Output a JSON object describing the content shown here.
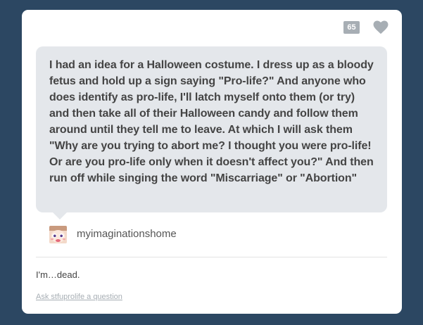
{
  "post": {
    "note_count": "65",
    "question": "I had an idea for a Halloween costume. I dress up as a bloody fetus and hold up a sign saying \"Pro-life?\" And anyone who does identify as pro-life, I'll latch myself onto them (or try) and then take all of their Halloween candy and follow them around until they tell me to leave. At which I will ask them \"Why are you trying to abort me? I thought you were pro-life! Or are you pro-life only when it doesn't affect you?\" And then run off while singing the word \"Miscarriage\" or \"Abortion\"",
    "asker": {
      "name": "myimaginationshome",
      "avatar_icon": "character-face-avatar"
    },
    "answer": "I'm…dead.",
    "ask_link": "Ask stfuprolife a question",
    "icons": {
      "like": "heart-icon"
    },
    "colors": {
      "background": "#2c4762",
      "card": "#ffffff",
      "bubble": "#e4e7eb",
      "note_badge": "#a7aeb4",
      "heart": "#a7aeb4",
      "link": "#a7aeb4",
      "text": "#444444"
    }
  }
}
